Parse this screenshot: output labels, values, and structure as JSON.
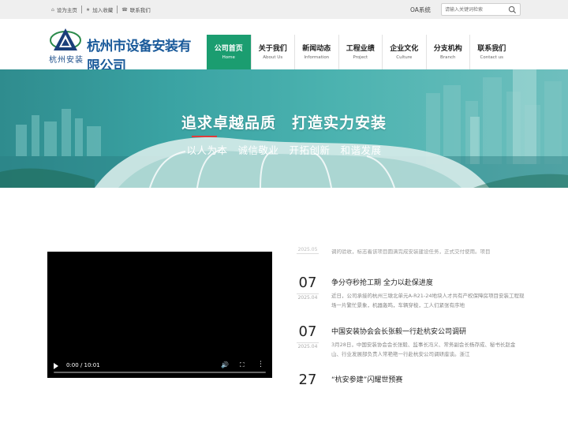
{
  "topbar": {
    "links": [
      {
        "icon": "home-icon",
        "glyph": "⌂",
        "label": "设为主页"
      },
      {
        "icon": "star-icon",
        "glyph": "★",
        "label": "加入收藏"
      },
      {
        "icon": "phone-icon",
        "glyph": "☎",
        "label": "联系我们"
      }
    ],
    "oa_label": "OA系统",
    "search_placeholder": "请输入关键词检索"
  },
  "header": {
    "company_name": "杭州市设备安装有限公司",
    "short_name": "杭州安装",
    "nav": [
      {
        "zh": "公司首页",
        "en": "Home",
        "active": true
      },
      {
        "zh": "关于我们",
        "en": "About Us",
        "active": false
      },
      {
        "zh": "新闻动态",
        "en": "Information",
        "active": false
      },
      {
        "zh": "工程业绩",
        "en": "Project",
        "active": false
      },
      {
        "zh": "企业文化",
        "en": "Culture",
        "active": false
      },
      {
        "zh": "分支机构",
        "en": "Branch",
        "active": false
      },
      {
        "zh": "联系我们",
        "en": "Contact us",
        "active": false
      }
    ]
  },
  "banner": {
    "title": "追求卓越品质　打造实力安装",
    "slogan": "以人为本　诚信敬业　开拓创新　和谐发展",
    "accent": "#e03a3a"
  },
  "video": {
    "time": "0:00 / 10:01",
    "progress": 0
  },
  "news": {
    "partial_summary": "调的验收，标志着该项目圆满完成安装建设任务，正式交付使用。项目",
    "partial_date": "2025.05",
    "items": [
      {
        "day": "07",
        "ym": "2025.04",
        "title": "争分夺秒抢工期 全力以赴保进度",
        "summary": "近日，公司承接的杭州三墩北单元A-R21-24地块人才共有产权保障房项目安装工程现场一片繁忙景象，机器轰鸣，车辆穿梭，工人们紧张有序地"
      },
      {
        "day": "07",
        "ym": "2025.04",
        "title": "中国安装协会会长张毅一行赴杭安公司调研",
        "summary": "3月28日，中国安装协会会长张毅、监事长冯义、常务副会长杨存成、秘书长赵金山、行业发展部负责人常艳艳一行赴杭安公司调研座谈。浙江"
      },
      {
        "day": "27",
        "ym": "",
        "title": "“杭安参建”闪耀世预赛",
        "summary": ""
      }
    ]
  },
  "colors": {
    "nav_active": "#1b9d70",
    "brand_blue": "#1a5a9a",
    "banner_teal": "#3aa3a3"
  }
}
